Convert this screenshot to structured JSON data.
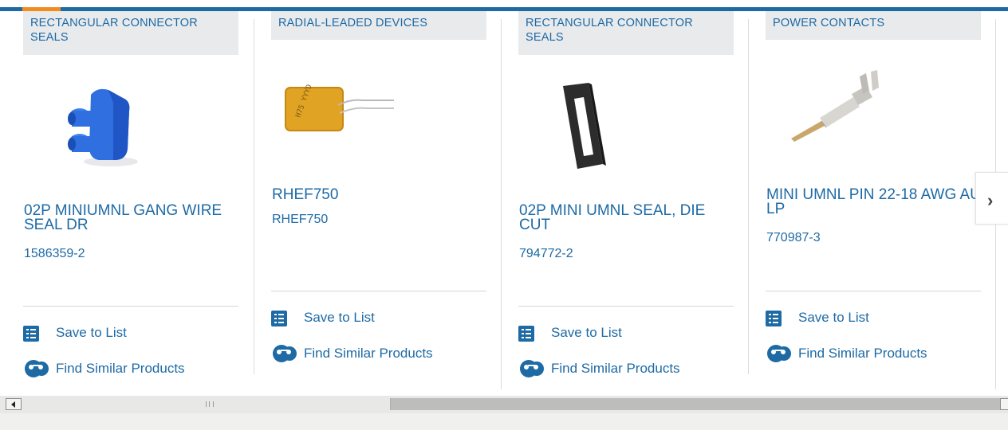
{
  "cards": [
    {
      "category": "RECTANGULAR CONNECTOR SEALS",
      "title": "02P MINIUMNL GANG WIRE SEAL DR",
      "part_number": "1586359-2",
      "image_desc": "blue-rubber-seal"
    },
    {
      "category": "RADIAL-LEADED DEVICES",
      "title": "RHEF750",
      "part_number": "RHEF750",
      "image_desc": "yellow-radial-device"
    },
    {
      "category": "RECTANGULAR CONNECTOR SEALS",
      "title": "02P MINI UMNL SEAL, DIE CUT",
      "part_number": "794772-2",
      "image_desc": "black-gasket"
    },
    {
      "category": "POWER CONTACTS",
      "title": "MINI UMNL PIN 22-18 AWG AU LP",
      "part_number": "770987-3",
      "image_desc": "metal-pin-contact"
    }
  ],
  "actions": {
    "save_label": "Save to List",
    "similar_label": "Find Similar Products"
  },
  "colors": {
    "brand_blue": "#1d6aa5",
    "accent_orange": "#f28c1e",
    "category_bg": "#e9eaec"
  },
  "carousel": {
    "next_icon": "chevron-right-icon"
  }
}
